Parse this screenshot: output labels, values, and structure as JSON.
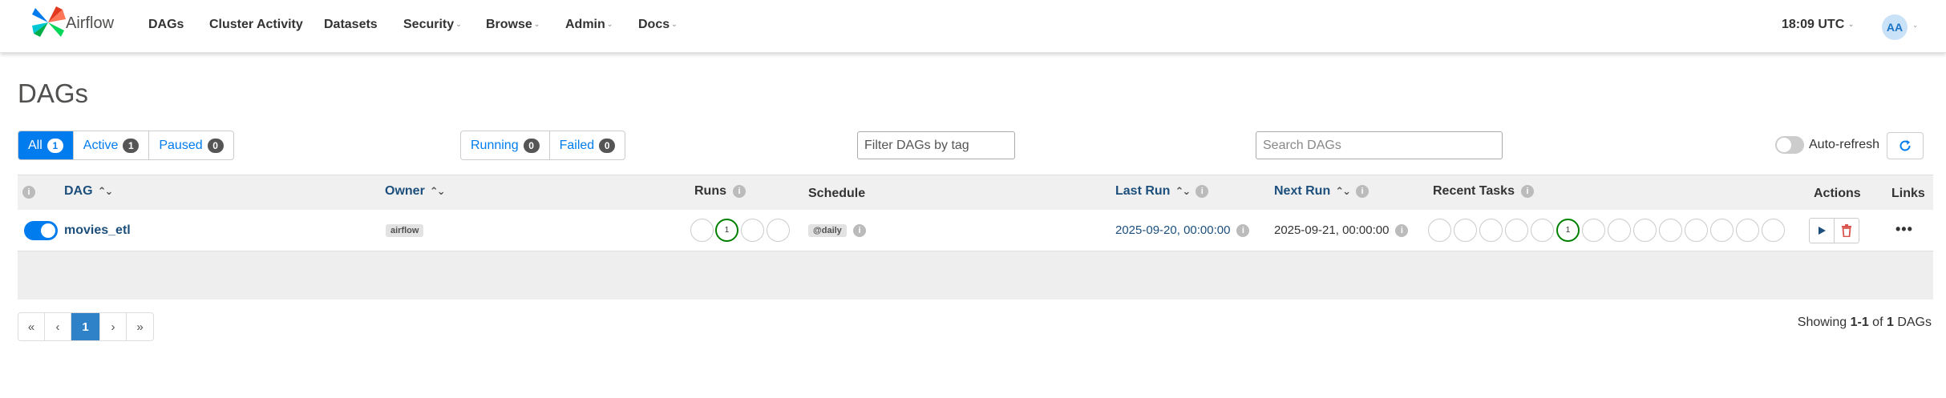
{
  "navbar": {
    "brand": "Airflow",
    "items": [
      {
        "label": "DAGs",
        "dropdown": false
      },
      {
        "label": "Cluster Activity",
        "dropdown": false
      },
      {
        "label": "Datasets",
        "dropdown": false
      },
      {
        "label": "Security",
        "dropdown": true
      },
      {
        "label": "Browse",
        "dropdown": true
      },
      {
        "label": "Admin",
        "dropdown": true
      },
      {
        "label": "Docs",
        "dropdown": true
      }
    ],
    "clock": "18:09 UTC",
    "user_initials": "AA"
  },
  "page_title": "DAGs",
  "status_filters": [
    {
      "label": "All",
      "count": "1",
      "active": true
    },
    {
      "label": "Active",
      "count": "1",
      "active": false
    },
    {
      "label": "Paused",
      "count": "0",
      "active": false
    }
  ],
  "run_filters": [
    {
      "label": "Running",
      "count": "0"
    },
    {
      "label": "Failed",
      "count": "0"
    }
  ],
  "tag_filter": {
    "placeholder": "Filter DAGs by tag"
  },
  "search": {
    "placeholder": "Search DAGs"
  },
  "auto_refresh": {
    "label": "Auto-refresh",
    "enabled": false
  },
  "table": {
    "headers": {
      "dag": "DAG",
      "owner": "Owner",
      "runs": "Runs",
      "schedule": "Schedule",
      "last_run": "Last Run",
      "next_run": "Next Run",
      "recent_tasks": "Recent Tasks",
      "actions": "Actions",
      "links": "Links"
    },
    "rows": [
      {
        "dag_id": "movies_etl",
        "enabled": true,
        "owner": "airflow",
        "runs": [
          "",
          "1",
          "",
          ""
        ],
        "schedule": "@daily",
        "last_run": "2025-09-20, 00:00:00",
        "next_run": "2025-09-21, 00:00:00",
        "recent_tasks": [
          "",
          "",
          "",
          "",
          "",
          "1",
          "",
          "",
          "",
          "",
          "",
          "",
          "",
          ""
        ]
      }
    ]
  },
  "pagination": {
    "first": "«",
    "prev": "‹",
    "current": "1",
    "next": "›",
    "last": "»"
  },
  "showing": {
    "prefix": "Showing ",
    "range": "1-1",
    "middle": " of ",
    "total": "1",
    "suffix": " DAGs"
  },
  "colors": {
    "primary": "#017cee",
    "success": "#008000",
    "link": "#1d4f7c",
    "danger": "#d9534f"
  },
  "icons": {
    "refresh": "refresh-icon",
    "info": "info-icon",
    "sort": "sort-icon",
    "play": "play-icon",
    "delete": "trash-icon",
    "more": "more-icon"
  }
}
